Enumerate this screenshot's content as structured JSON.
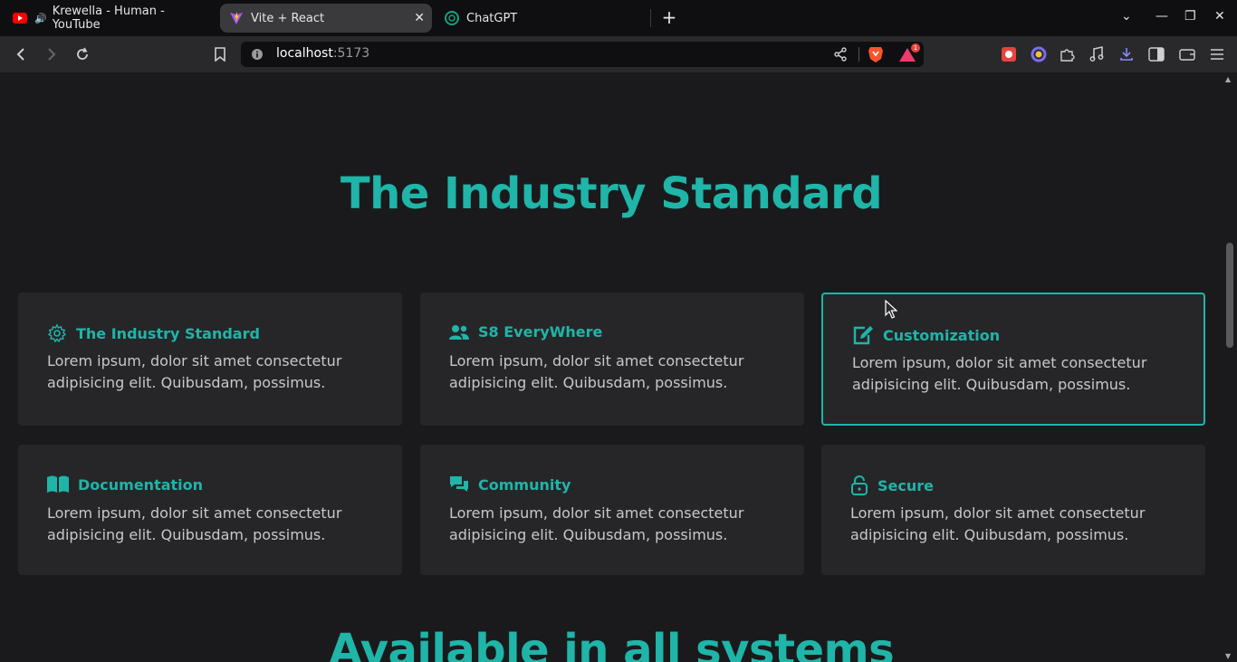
{
  "browser": {
    "tabs": [
      {
        "title": "Krewella - Human - YouTube",
        "icon": "youtube-icon",
        "audio": true
      },
      {
        "title": "Vite + React",
        "icon": "vite-icon",
        "active": true
      },
      {
        "title": "ChatGPT",
        "icon": "chatgpt-icon"
      }
    ],
    "url_host": "localhost",
    "url_port": ":5173",
    "notification_count": "1"
  },
  "page": {
    "heading": "The Industry Standard",
    "cards": [
      {
        "title": "The Industry Standard",
        "icon": "gear-icon",
        "body": "Lorem ipsum, dolor sit amet consectetur adipisicing elit. Quibusdam, possimus."
      },
      {
        "title": "S8 EveryWhere",
        "icon": "users-icon",
        "body": "Lorem ipsum, dolor sit amet consectetur adipisicing elit. Quibusdam, possimus."
      },
      {
        "title": "Customization",
        "icon": "edit-icon",
        "body": "Lorem ipsum, dolor sit amet consectetur adipisicing elit. Quibusdam, possimus."
      },
      {
        "title": "Documentation",
        "icon": "book-icon",
        "body": "Lorem ipsum, dolor sit amet consectetur adipisicing elit. Quibusdam, possimus."
      },
      {
        "title": "Community",
        "icon": "comments-icon",
        "body": "Lorem ipsum, dolor sit amet consectetur adipisicing elit. Quibusdam, possimus."
      },
      {
        "title": "Secure",
        "icon": "lock-icon",
        "body": "Lorem ipsum, dolor sit amet consectetur adipisicing elit. Quibusdam, possimus."
      }
    ],
    "heading2": "Available in all systems"
  },
  "colors": {
    "accent": "#1fb5a8",
    "card_bg": "#262629",
    "page_bg": "#1a1a1c"
  }
}
